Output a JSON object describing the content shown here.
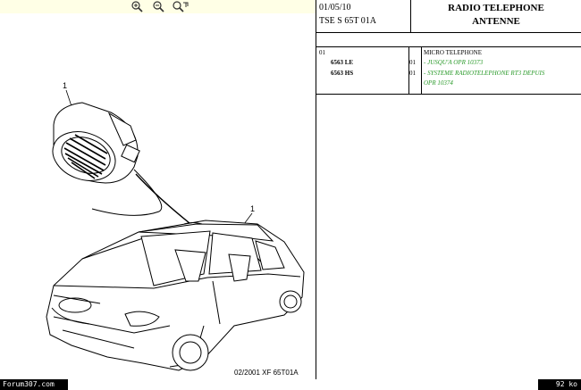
{
  "header": {
    "date": "01/05/10",
    "reference": "TSE S 65T 01A",
    "title_line1": "RADIO TELEPHONE",
    "title_line2": "ANTENNE"
  },
  "figure": {
    "code": "02/2001  XF 65T01A",
    "callouts": [
      "1",
      "1"
    ]
  },
  "parts_table": {
    "group_code": "01",
    "group_label": "MICRO TELEPHONE",
    "rows": [
      {
        "ref": "6563 LE",
        "qty": "01",
        "description": "- JUSQU'A OPR 10373"
      },
      {
        "ref": "6563 HS",
        "qty": "01",
        "description": "- SYSTEME RADIOTELEPHONE RT3 DEPUIS"
      }
    ],
    "continuation": "OPR 10374"
  },
  "footer": {
    "brand": "Forum307.com",
    "filesize": "92 ko"
  },
  "colors": {
    "zoombar": "#ffffe6",
    "green_text": "#2a9a2a"
  }
}
